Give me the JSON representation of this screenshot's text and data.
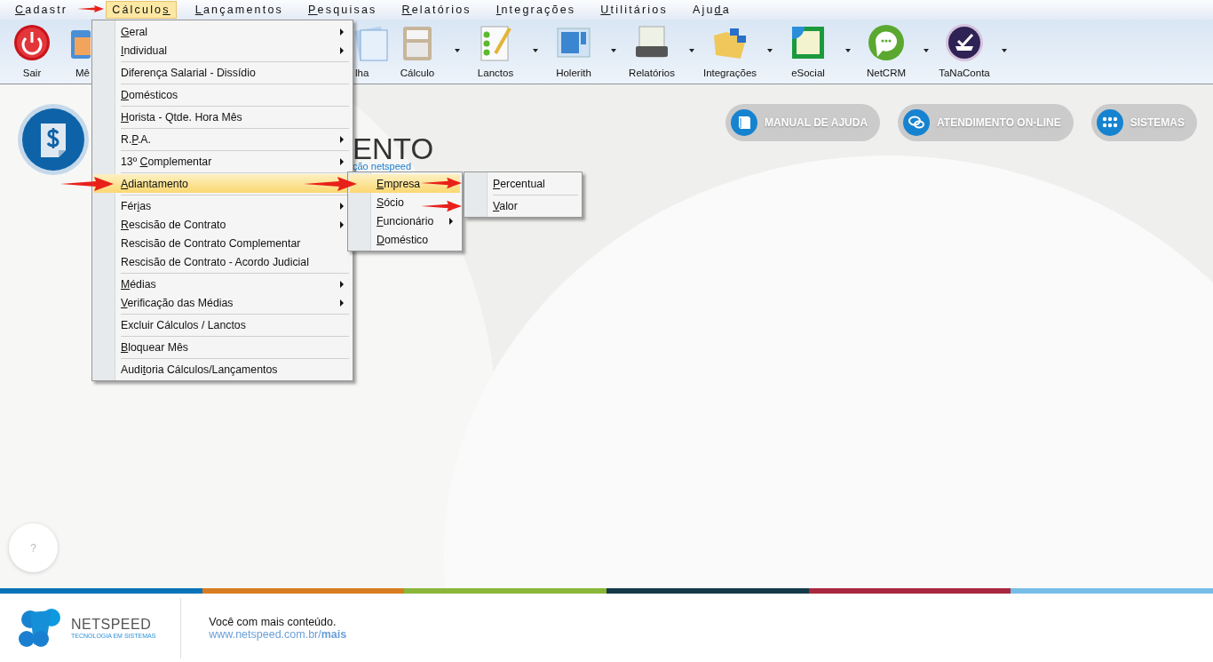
{
  "menu_bar": [
    {
      "key": "C",
      "post": "adastr",
      "selected": false
    },
    {
      "pre": "Cálculo",
      "key": "s",
      "selected": true
    },
    {
      "key": "L",
      "post": "ançamentos",
      "selected": false
    },
    {
      "key": "P",
      "post": "esquisas",
      "selected": false
    },
    {
      "key": "R",
      "post": "elatórios",
      "selected": false
    },
    {
      "key": "I",
      "post": "ntegrações",
      "selected": false
    },
    {
      "key": "U",
      "post": "tilitários",
      "selected": false
    },
    {
      "pre": "Aju",
      "key": "d",
      "post": "a",
      "selected": false
    }
  ],
  "toolbar": [
    {
      "label": "Sair",
      "has_dropdown": false
    },
    {
      "label": "Mê",
      "has_dropdown": false
    },
    {
      "label": "lha",
      "has_dropdown": false
    },
    {
      "label": "Cálculo",
      "has_dropdown": true
    },
    {
      "label": "Lanctos",
      "has_dropdown": true
    },
    {
      "label": "Holerith",
      "has_dropdown": true
    },
    {
      "label": "Relatórios",
      "has_dropdown": true
    },
    {
      "label": "Integrações",
      "has_dropdown": true
    },
    {
      "label": "eSocial",
      "has_dropdown": true
    },
    {
      "label": "NetCRM",
      "has_dropdown": true
    },
    {
      "label": "TaNaConta",
      "has_dropdown": true
    }
  ],
  "open_menu": {
    "items": [
      {
        "kind": "item",
        "key": "G",
        "post": "eral",
        "has_submenu": true,
        "selected": false
      },
      {
        "kind": "item",
        "key": "I",
        "post": "ndividual",
        "has_submenu": true,
        "selected": false
      },
      {
        "kind": "separator"
      },
      {
        "kind": "item",
        "post": "Diferença Salarial - Dissídio",
        "has_submenu": false,
        "selected": false
      },
      {
        "kind": "separator"
      },
      {
        "kind": "item",
        "key": "D",
        "post": "omésticos",
        "has_submenu": false,
        "selected": false
      },
      {
        "kind": "separator"
      },
      {
        "kind": "item",
        "key": "H",
        "post": "orista - Qtde. Hora Mês",
        "has_submenu": false,
        "selected": false
      },
      {
        "kind": "separator"
      },
      {
        "kind": "item",
        "pre": "R.",
        "key": "P",
        "post": ".A.",
        "has_submenu": true,
        "selected": false
      },
      {
        "kind": "separator"
      },
      {
        "kind": "item",
        "pre": "13º ",
        "key": "C",
        "post": "omplementar",
        "has_submenu": true,
        "selected": false
      },
      {
        "kind": "separator"
      },
      {
        "kind": "item",
        "key": "A",
        "post": "diantamento",
        "has_submenu": false,
        "selected": true
      },
      {
        "kind": "separator"
      },
      {
        "kind": "item",
        "pre": "Fér",
        "key": "i",
        "post": "as",
        "has_submenu": true,
        "selected": false
      },
      {
        "kind": "item",
        "key": "R",
        "post": "escisão de Contrato",
        "has_submenu": true,
        "selected": false
      },
      {
        "kind": "item",
        "post": "Rescisão de Contrato Complementar",
        "has_submenu": false,
        "selected": false
      },
      {
        "kind": "item",
        "post": "Rescisão de Contrato - Acordo Judicial",
        "has_submenu": false,
        "selected": false
      },
      {
        "kind": "separator"
      },
      {
        "kind": "item",
        "key": "M",
        "post": "édias",
        "has_submenu": true,
        "selected": false
      },
      {
        "kind": "item",
        "key": "V",
        "post": "erificação das Médias",
        "has_submenu": true,
        "selected": false
      },
      {
        "kind": "separator"
      },
      {
        "kind": "item",
        "post": "Excluir Cálculos / Lanctos",
        "has_submenu": false,
        "selected": false
      },
      {
        "kind": "separator"
      },
      {
        "kind": "item",
        "key": "B",
        "post": "loquear Mês",
        "has_submenu": false,
        "selected": false
      },
      {
        "kind": "separator"
      },
      {
        "kind": "item",
        "pre": "Audi",
        "key": "t",
        "post": "oria Cálculos/Lançamentos",
        "has_submenu": false,
        "selected": false
      }
    ]
  },
  "submenu": {
    "items": [
      {
        "kind": "item",
        "key": "E",
        "post": "mpresa",
        "has_submenu": false,
        "selected": true
      },
      {
        "kind": "item",
        "key": "S",
        "post": "ócio",
        "has_submenu": false,
        "selected": false
      },
      {
        "kind": "item",
        "key": "F",
        "post": "uncionário",
        "has_submenu": true,
        "selected": false
      },
      {
        "kind": "item",
        "key": "D",
        "post": "oméstico",
        "has_submenu": false,
        "selected": false
      }
    ]
  },
  "submenu_2": {
    "items": [
      {
        "kind": "item",
        "key": "P",
        "post": "ercentual",
        "has_submenu": false,
        "selected": false
      },
      {
        "kind": "separator"
      },
      {
        "kind": "item",
        "key": "V",
        "post": "alor",
        "has_submenu": false,
        "selected": false
      }
    ]
  },
  "page_title": "ENTO",
  "page_subtitle": "ção netspeed",
  "header_buttons": [
    "MANUAL DE AJUDA",
    "ATENDIMENTO ON-LINE",
    "SISTEMAS"
  ],
  "help_button": "?",
  "footer": {
    "brand": "NETSPEED",
    "tagline": "TECNOLOGIA EM SISTEMAS",
    "message": "Você com mais conteúdo.",
    "link": "www.netspeed.com.br/**mais**"
  }
}
